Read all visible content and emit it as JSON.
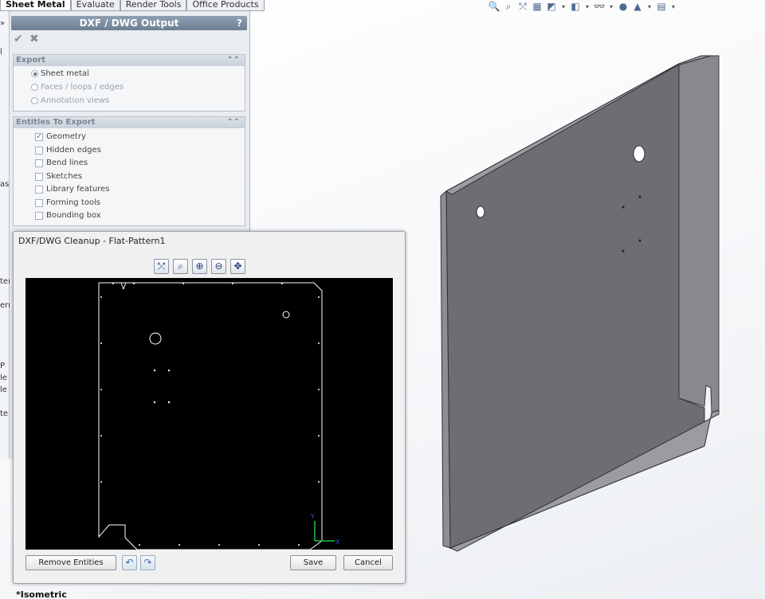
{
  "tabs": [
    "Sheet Metal",
    "Evaluate",
    "Render Tools",
    "Office Products"
  ],
  "left_strip": {
    "fragments": [
      "»",
      "l",
      "as",
      "ter",
      "ern",
      "P",
      "le",
      "le",
      "te"
    ]
  },
  "property_manager": {
    "title": "DXF / DWG Output",
    "help": "?",
    "ok_icon": "checkmark-icon",
    "cancel_icon": "x-icon",
    "export_group": {
      "title": "Export",
      "options": [
        "Sheet metal",
        "Faces / loops / edges",
        "Annotation views"
      ],
      "selected": "Sheet metal"
    },
    "entities_group": {
      "title": "Entities To Export",
      "options": [
        {
          "label": "Geometry",
          "checked": true
        },
        {
          "label": "Hidden edges",
          "checked": false
        },
        {
          "label": "Bend lines",
          "checked": false
        },
        {
          "label": "Sketches",
          "checked": false
        },
        {
          "label": "Library features",
          "checked": false
        },
        {
          "label": "Forming tools",
          "checked": false
        },
        {
          "label": "Bounding box",
          "checked": false
        }
      ]
    }
  },
  "dialog": {
    "title": "DXF/DWG Cleanup - Flat-Pattern1",
    "toolbar_icons": [
      "select-icon",
      "zoom-fit-icon",
      "zoom-area-icon",
      "zoom-in-out-icon",
      "pan-icon"
    ],
    "buttons": {
      "remove": "Remove Entities",
      "save": "Save",
      "cancel": "Cancel"
    },
    "axis_labels": {
      "y": "Y",
      "x": "X"
    }
  },
  "hud_icons": [
    "zoom-to-fit-icon",
    "zoom-area-icon",
    "previous-view-icon",
    "section-view-icon",
    "view-orientation-icon",
    "display-style-icon",
    "hide-show-icon",
    "appearance-icon",
    "scene-icon",
    "view-settings-icon"
  ],
  "view_label": "*Isometric",
  "colors": {
    "part_face": "#6a6c70",
    "part_edge": "#3a3c40",
    "preview_bg": "#000000",
    "preview_line": "#ffffff",
    "title_bar": "#7b8ca0"
  }
}
